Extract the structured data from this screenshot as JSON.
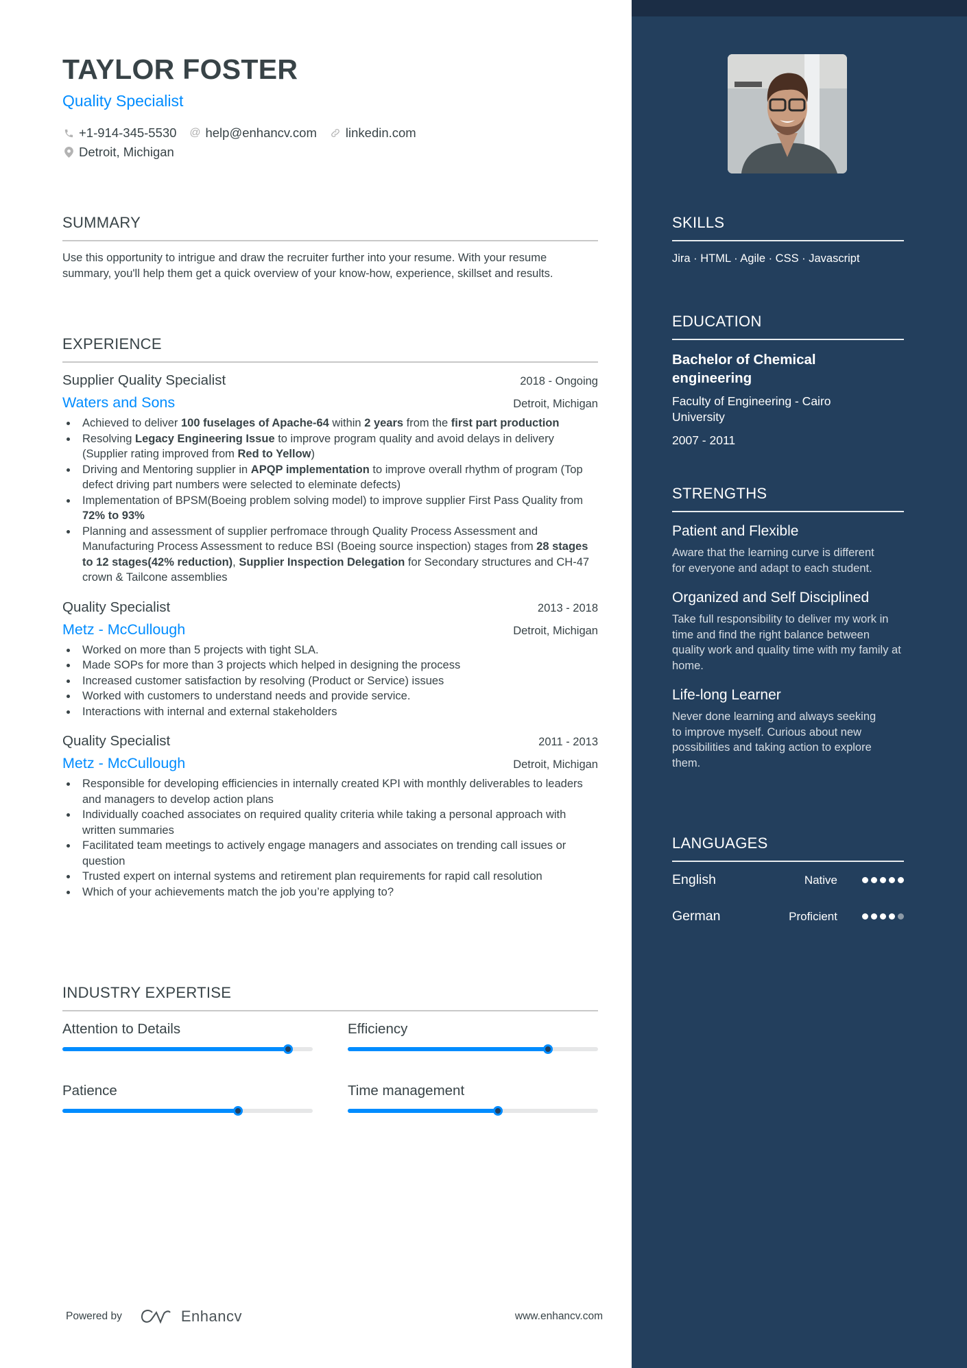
{
  "header": {
    "name": "TAYLOR FOSTER",
    "title": "Quality Specialist",
    "contacts": [
      {
        "icon": "phone-icon",
        "text": "+1-914-345-5530"
      },
      {
        "icon": "at-icon",
        "text": "help@enhancv.com"
      },
      {
        "icon": "link-icon",
        "text": "linkedin.com"
      },
      {
        "icon": "location-pin-icon",
        "text": "Detroit, Michigan"
      }
    ]
  },
  "summary": {
    "title": "SUMMARY",
    "text": "Use this opportunity to intrigue and draw the recruiter further into your resume. With your resume summary, you'll help them get a quick overview of your know-how, experience, skillset and results."
  },
  "experience": {
    "title": "EXPERIENCE",
    "jobs": [
      {
        "role": "Supplier Quality Specialist",
        "dates": "2018 - Ongoing",
        "company": "Waters and Sons",
        "location": "Detroit, Michigan",
        "bullets": [
          [
            {
              "t": "Achieved to deliver "
            },
            {
              "t": "100 fuselages of Apache-64",
              "b": true
            },
            {
              "t": " within "
            },
            {
              "t": "2 years",
              "b": true
            },
            {
              "t": " from the "
            },
            {
              "t": "first part production",
              "b": true
            }
          ],
          [
            {
              "t": "Resolving "
            },
            {
              "t": "Legacy Engineering Issue",
              "b": true
            },
            {
              "t": " to improve program quality and avoid delays in delivery (Supplier rating improved from "
            },
            {
              "t": "Red to Yellow",
              "b": true
            },
            {
              "t": ")"
            }
          ],
          [
            {
              "t": "Driving and Mentoring supplier in "
            },
            {
              "t": "APQP implementation",
              "b": true
            },
            {
              "t": " to improve overall rhythm of program (Top defect driving part numbers were selected to eleminate defects)"
            }
          ],
          [
            {
              "t": "Implementation of BPSM(Boeing problem solving model) to improve supplier First Pass Quality from "
            },
            {
              "t": "72% to 93%",
              "b": true
            }
          ],
          [
            {
              "t": "Planning and assessment of supplier perfromace through Quality Process Assessment and Manufacturing Process Assessment to reduce BSI (Boeing source inspection) stages from "
            },
            {
              "t": "28 stages to 12 stages(42% reduction)",
              "b": true
            },
            {
              "t": ", "
            },
            {
              "t": "Supplier Inspection Delegation",
              "b": true
            },
            {
              "t": " for Secondary structures and CH-47 crown & Tailcone assemblies"
            }
          ]
        ]
      },
      {
        "role": "Quality Specialist",
        "dates": "2013 - 2018",
        "company": "Metz - McCullough",
        "location": "Detroit, Michigan",
        "bullets": [
          [
            {
              "t": "Worked on more than 5 projects with tight SLA."
            }
          ],
          [
            {
              "t": "Made SOPs for more than 3 projects which helped in designing the process"
            }
          ],
          [
            {
              "t": "Increased customer satisfaction by resolving (Product or Service) issues"
            }
          ],
          [
            {
              "t": "Worked with customers to understand needs and provide service."
            }
          ],
          [
            {
              "t": "Interactions with internal and external stakeholders"
            }
          ]
        ]
      },
      {
        "role": "Quality Specialist",
        "dates": "2011 - 2013",
        "company": "Metz - McCullough",
        "location": "Detroit, Michigan",
        "bullets": [
          [
            {
              "t": "Responsible for developing efficiencies in internally created KPI with monthly deliverables to leaders and managers to develop action plans"
            }
          ],
          [
            {
              "t": "Individually coached associates on required quality criteria while taking a personal approach with written summaries"
            }
          ],
          [
            {
              "t": "Facilitated team meetings to actively engage managers and associates on trending call issues or question"
            }
          ],
          [
            {
              "t": "Trusted expert on internal systems and retirement plan requirements for rapid call resolution"
            }
          ],
          [
            {
              "t": "Which of your achievements match the job you’re applying to?"
            }
          ]
        ]
      }
    ]
  },
  "expertise": {
    "title": "INDUSTRY EXPERTISE",
    "items": [
      {
        "label": "Attention to Details",
        "level": 0.9
      },
      {
        "label": "Efficiency",
        "level": 0.8
      },
      {
        "label": "Patience",
        "level": 0.7
      },
      {
        "label": "Time management",
        "level": 0.6
      }
    ]
  },
  "footer": {
    "powered_by": "Powered by",
    "brand": "Enhancv",
    "website": "www.enhancv.com"
  },
  "sidebar": {
    "photo_alt": "Profile photo of Taylor Foster",
    "skills": {
      "title": "SKILLS",
      "text": "Jira · HTML · Agile · CSS · Javascript"
    },
    "education": {
      "title": "EDUCATION",
      "degree": "Bachelor of Chemical engineering",
      "school": "Faculty of Engineering - Cairo University",
      "dates": "2007 - 2011"
    },
    "strengths": {
      "title": "STRENGTHS",
      "items": [
        {
          "title": "Patient and Flexible",
          "desc": "Aware that the learning curve is different for everyone and adapt to each student."
        },
        {
          "title": "Organized and Self Disciplined",
          "desc": "Take full responsibility to deliver my work in time and find the right balance between quality work and quality time with my family at home."
        },
        {
          "title": "Life-long Learner",
          "desc": "Never done learning and always seeking to improve myself. Curious about new possibilities and taking action to explore them."
        }
      ]
    },
    "languages": {
      "title": "LANGUAGES",
      "items": [
        {
          "name": "English",
          "level": "Native",
          "rating": 5,
          "max": 5
        },
        {
          "name": "German",
          "level": "Proficient",
          "rating": 4,
          "max": 5
        }
      ]
    }
  },
  "colors": {
    "accent": "#008cff",
    "sidebar": "#233f5d",
    "sidebar_top": "#1b2d45",
    "text": "#384347"
  }
}
